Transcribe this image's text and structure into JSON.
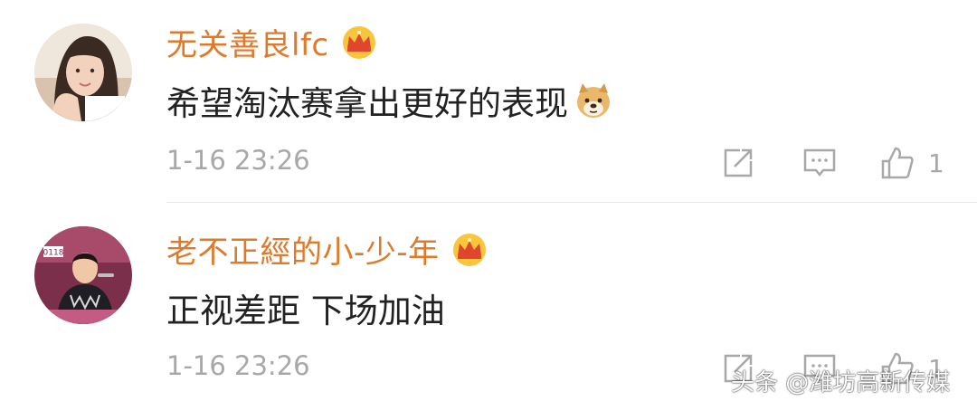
{
  "comments": [
    {
      "username": "无关善良lfc",
      "text": "希望淘汰赛拿出更好的表现",
      "emoji": "doge-emoji-icon",
      "time": "1-16 23:26",
      "likes": "1"
    },
    {
      "username": "老不正經的小-少-年",
      "text": "正视差距 下场加油",
      "time": "1-16 23:26",
      "likes": "1",
      "avatar_badge": "0118"
    }
  ],
  "colors": {
    "username": "#e07a2a",
    "text": "#222222",
    "meta": "#a8a8a8",
    "divider": "#e6e6e6"
  },
  "icons": [
    "crown-icon",
    "repost-icon",
    "comment-icon",
    "like-icon"
  ],
  "watermark": "头条 @潍坊高新传媒"
}
